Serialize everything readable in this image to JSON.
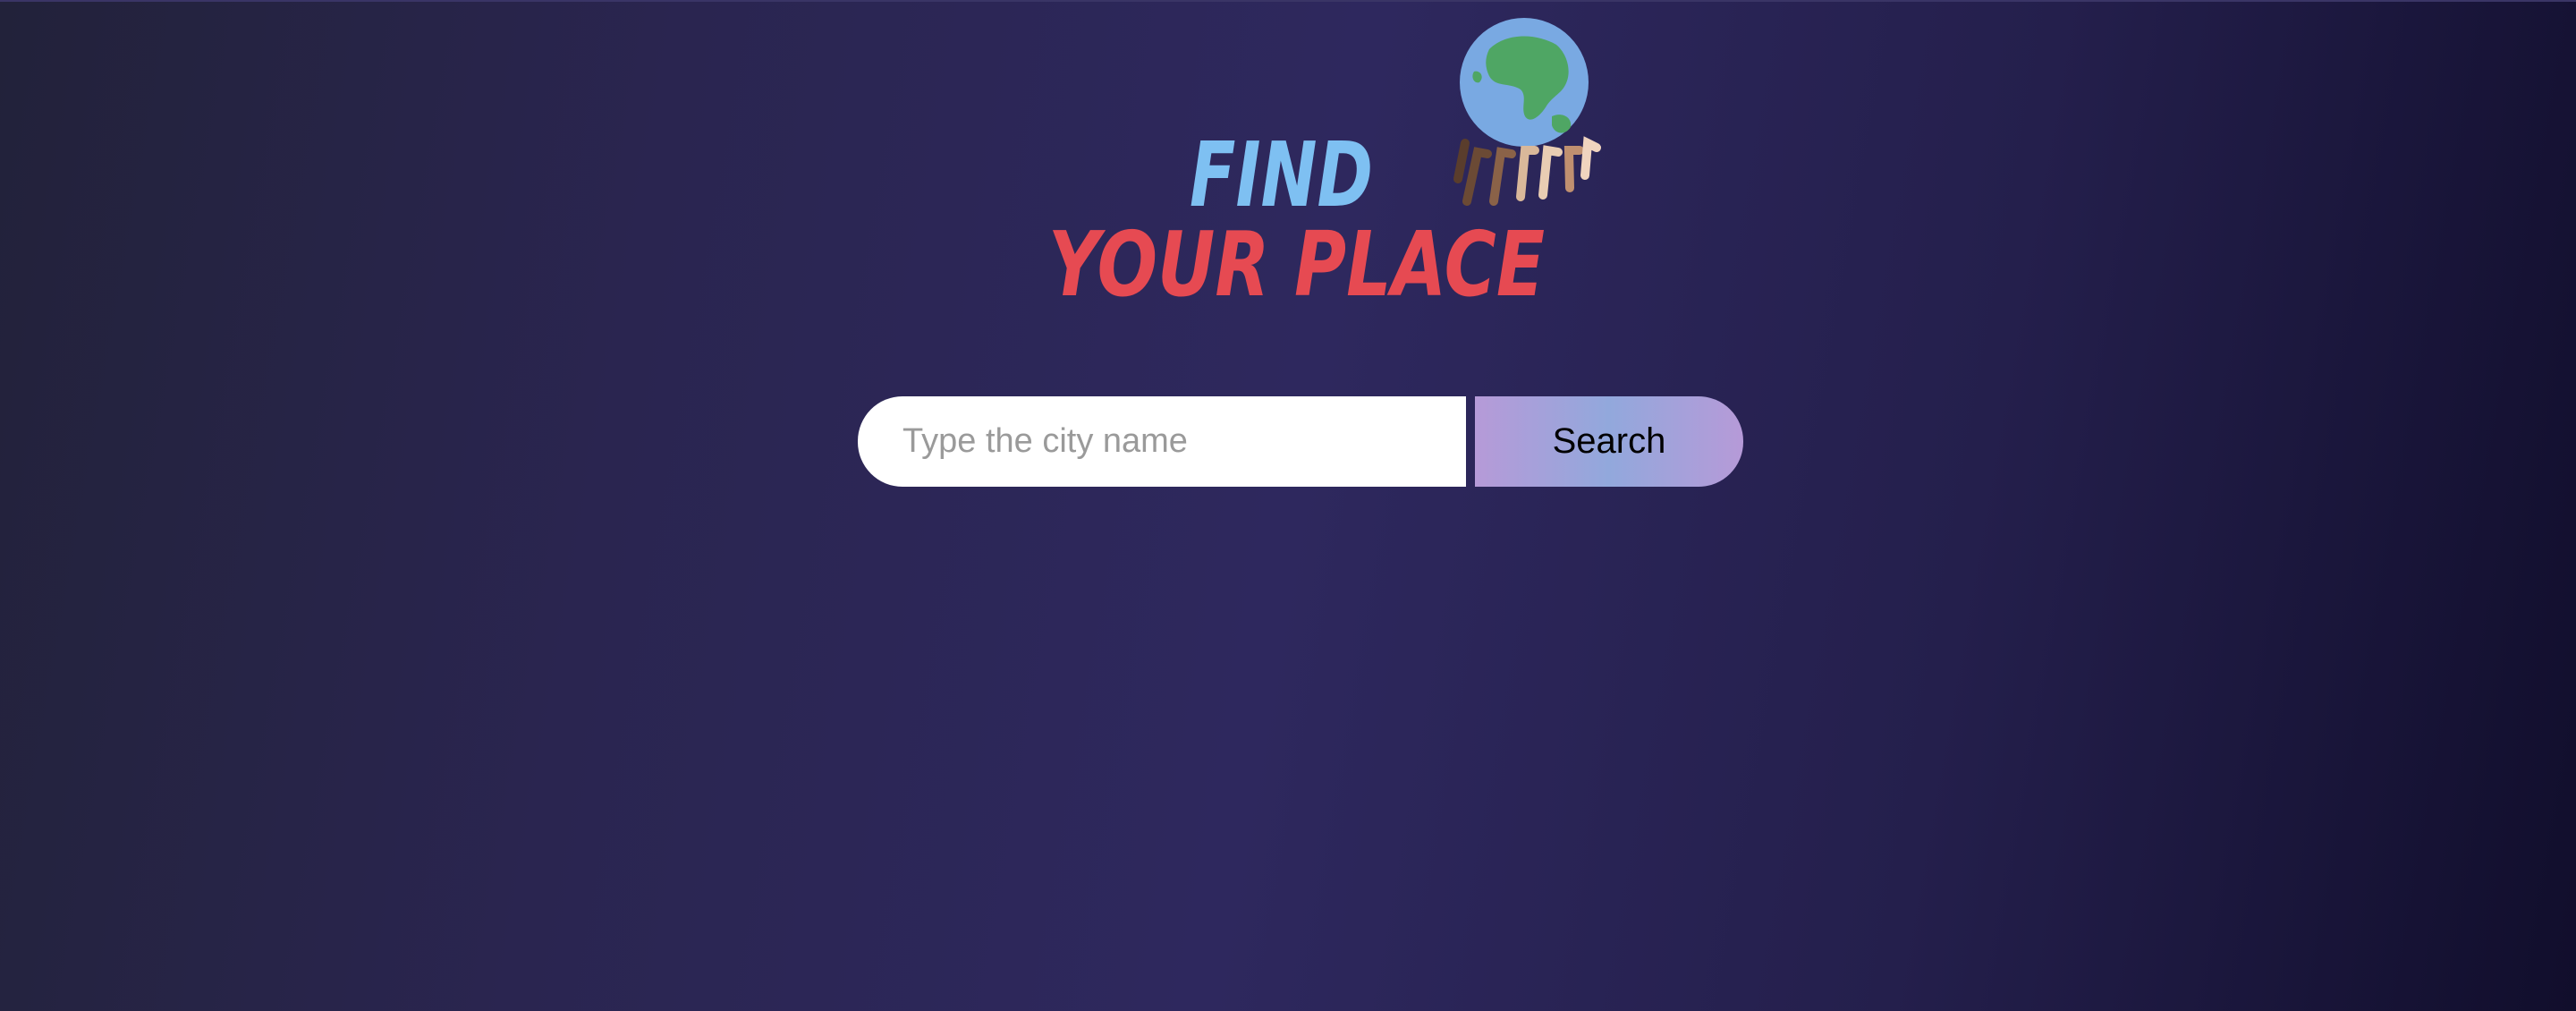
{
  "logo": {
    "line1": "FIND",
    "line2": "YOUR PLACE",
    "colors": {
      "line1": "#7ec0f2",
      "line2": "#e64a52",
      "ocean": "#79a9e2",
      "land": "#4fa664"
    },
    "icon": "globe-with-hands-icon"
  },
  "search": {
    "placeholder": "Type the city name",
    "value": "",
    "button_label": "Search"
  }
}
